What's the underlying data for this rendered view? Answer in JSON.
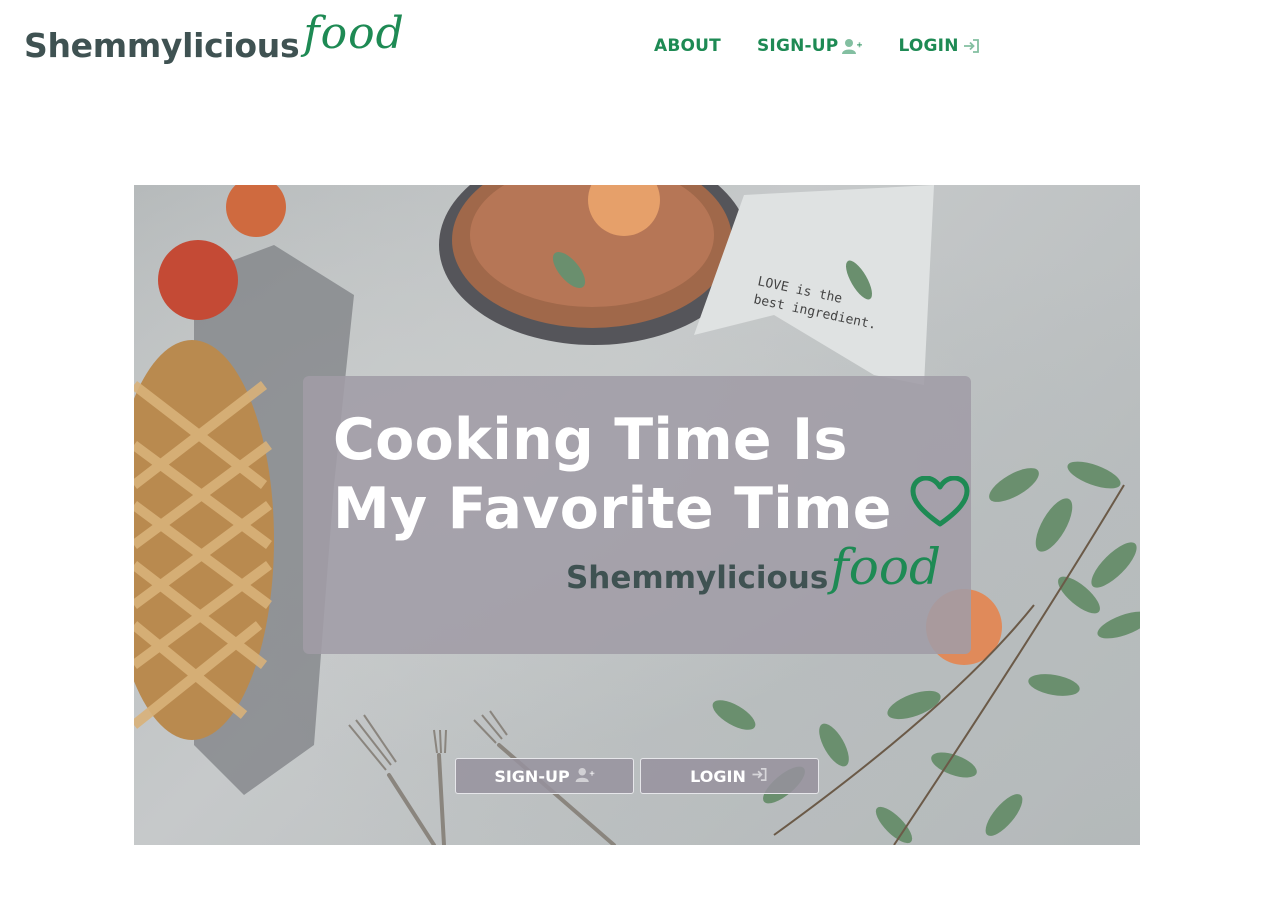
{
  "brand": {
    "name": "Shemmylicious",
    "script": "food",
    "colors": {
      "dark": "#3f5252",
      "green": "#1e8a54"
    }
  },
  "nav": {
    "about": "ABOUT",
    "signup": "SIGN-UP",
    "login": "LOGIN"
  },
  "hero": {
    "headline_line1": "Cooking Time Is",
    "headline_line2": "My Favorite Time",
    "heart_icon": "heart-outline-icon",
    "logo_name": "Shemmylicious",
    "logo_script": "food",
    "napkin_text_line1": "LOVE is the",
    "napkin_text_line2": "best ingredient.",
    "buttons": {
      "signup": "SIGN-UP",
      "login": "LOGIN"
    }
  },
  "icons": {
    "user_plus": "user-plus-icon",
    "sign_in": "sign-in-icon"
  }
}
